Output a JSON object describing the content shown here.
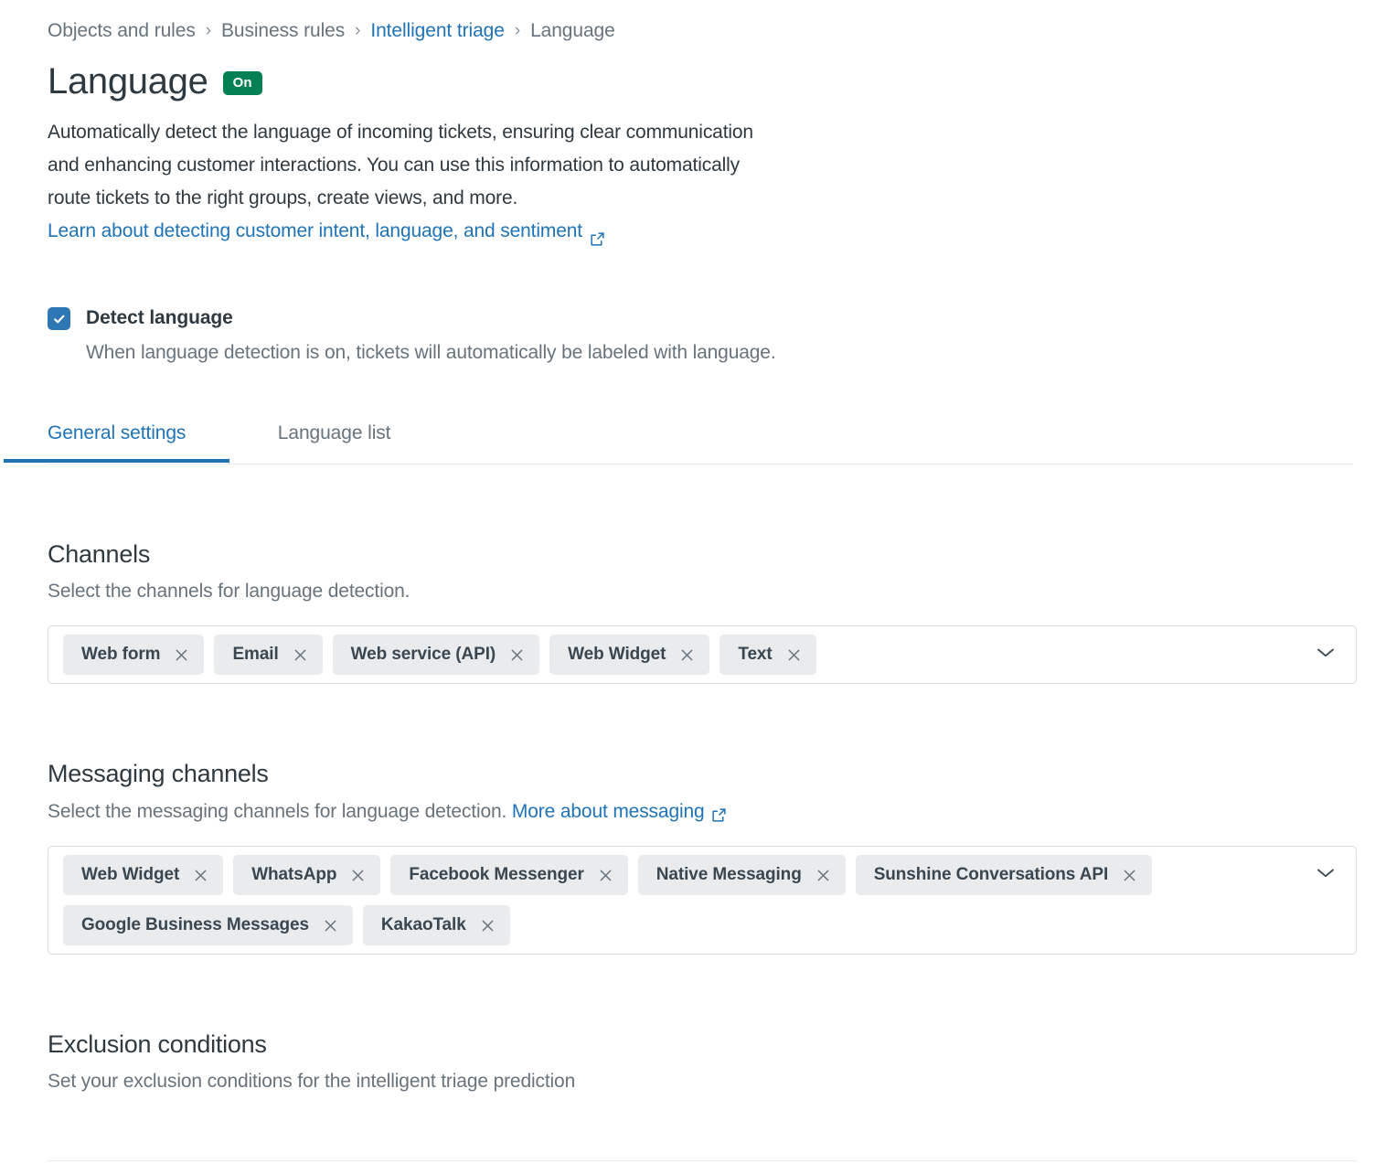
{
  "breadcrumb": {
    "separator": "›",
    "items": [
      {
        "label": "Objects and rules",
        "type": "muted"
      },
      {
        "label": "Business rules",
        "type": "muted"
      },
      {
        "label": "Intelligent triage",
        "type": "link"
      },
      {
        "label": "Language",
        "type": "current"
      }
    ]
  },
  "header": {
    "title": "Language",
    "status_badge": "On",
    "status_color": "#038153",
    "description_line1": "Automatically detect the language of incoming tickets, ensuring clear communication",
    "description_line2": "and enhancing customer interactions. You can use this information to automatically",
    "description_line3": "route tickets to the right groups, create views, and more.",
    "learn_link": "Learn about detecting customer intent, language, and sentiment",
    "learn_link_icon": "external-link-icon"
  },
  "detect_language": {
    "checked": true,
    "checkbox_color": "#2e77b5",
    "label": "Detect language",
    "help": "When language detection is on, tickets will automatically be labeled with language."
  },
  "tabs": {
    "active_index": 0,
    "accent_color": "#1f73b7",
    "items": [
      {
        "label": "General settings"
      },
      {
        "label": "Language list"
      }
    ]
  },
  "channels": {
    "title": "Channels",
    "subtitle": "Select the channels for language detection.",
    "dropdown_icon": "chevron-down-icon",
    "tags": [
      {
        "label": "Web form"
      },
      {
        "label": "Email"
      },
      {
        "label": "Web service (API)"
      },
      {
        "label": "Web Widget"
      },
      {
        "label": "Text"
      }
    ]
  },
  "messaging_channels": {
    "title": "Messaging channels",
    "subtitle": "Select the messaging channels for language detection.",
    "more_link": "More about messaging",
    "more_link_icon": "external-link-icon",
    "dropdown_icon": "chevron-down-icon",
    "tags": [
      {
        "label": "Web Widget"
      },
      {
        "label": "WhatsApp"
      },
      {
        "label": "Facebook Messenger"
      },
      {
        "label": "Native Messaging"
      },
      {
        "label": "Sunshine Conversations API"
      },
      {
        "label": "Google Business Messages"
      },
      {
        "label": "KakaoTalk"
      }
    ]
  },
  "exclusion_conditions": {
    "title": "Exclusion conditions",
    "subtitle": "Set your exclusion conditions for the intelligent triage prediction"
  }
}
